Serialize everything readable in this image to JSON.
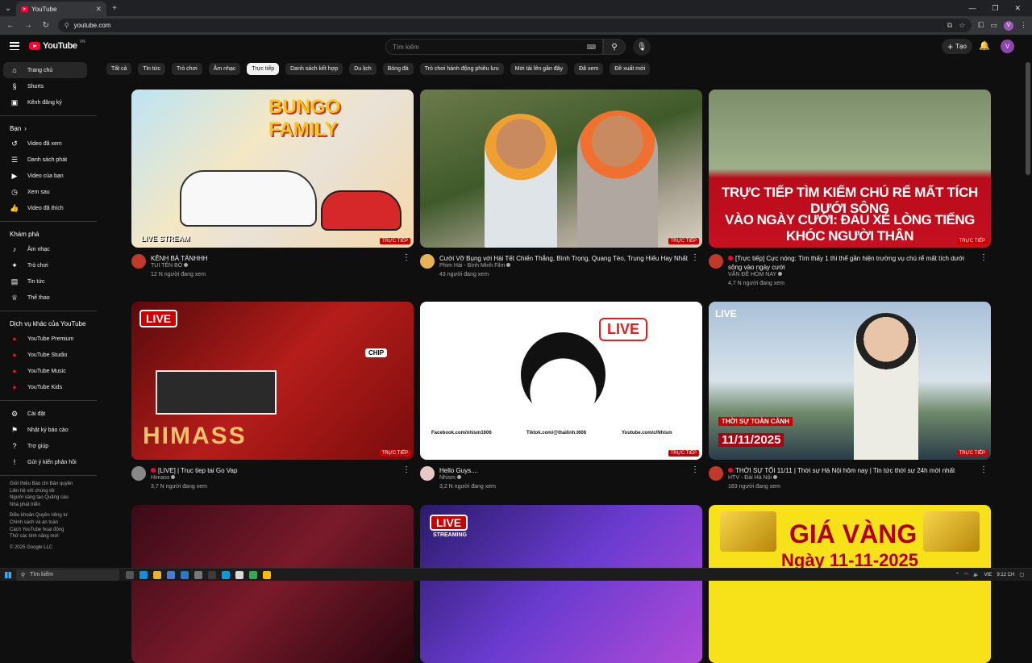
{
  "browser": {
    "tab_title": "YouTube",
    "url": "youtube.com"
  },
  "header": {
    "logo_text": "YouTube",
    "region": "VN",
    "search_placeholder": "Tìm kiếm",
    "create_label": "Tạo",
    "avatar_letter": "V"
  },
  "sidebar": {
    "main": [
      {
        "label": "Trang chủ",
        "icon": "home-icon",
        "glyph": "⌂"
      },
      {
        "label": "Shorts",
        "icon": "shorts-icon",
        "glyph": "§"
      },
      {
        "label": "Kênh đăng ký",
        "icon": "subscriptions-icon",
        "glyph": "▣"
      }
    ],
    "you_header": "Bạn",
    "you": [
      {
        "label": "Video đã xem",
        "icon": "history-icon",
        "glyph": "↺"
      },
      {
        "label": "Danh sách phát",
        "icon": "playlists-icon",
        "glyph": "☰"
      },
      {
        "label": "Video của bạn",
        "icon": "your-videos-icon",
        "glyph": "▶"
      },
      {
        "label": "Xem sau",
        "icon": "watch-later-icon",
        "glyph": "◷"
      },
      {
        "label": "Video đã thích",
        "icon": "liked-videos-icon",
        "glyph": "👍"
      }
    ],
    "explore_header": "Khám phá",
    "explore": [
      {
        "label": "Âm nhạc",
        "icon": "music-icon",
        "glyph": "♪"
      },
      {
        "label": "Trò chơi",
        "icon": "gaming-icon",
        "glyph": "✦"
      },
      {
        "label": "Tin tức",
        "icon": "news-icon",
        "glyph": "▤"
      },
      {
        "label": "Thể thao",
        "icon": "sports-icon",
        "glyph": "♕"
      }
    ],
    "more_header": "Dịch vụ khác của YouTube",
    "more": [
      {
        "label": "YouTube Premium",
        "icon": "youtube-premium-icon",
        "glyph": "●"
      },
      {
        "label": "YouTube Studio",
        "icon": "youtube-studio-icon",
        "glyph": "●"
      },
      {
        "label": "YouTube Music",
        "icon": "youtube-music-icon",
        "glyph": "●"
      },
      {
        "label": "YouTube Kids",
        "icon": "youtube-kids-icon",
        "glyph": "●"
      }
    ],
    "settings": [
      {
        "label": "Cài đặt",
        "icon": "settings-icon",
        "glyph": "⚙"
      },
      {
        "label": "Nhật ký báo cáo",
        "icon": "report-history-icon",
        "glyph": "⚑"
      },
      {
        "label": "Trợ giúp",
        "icon": "help-icon",
        "glyph": "?"
      },
      {
        "label": "Gửi ý kiến phản hồi",
        "icon": "feedback-icon",
        "glyph": "!"
      }
    ],
    "footer1": [
      "Giới thiệu  Báo chí  Bản quyền",
      "Liên hệ với chúng tôi",
      "Người sáng tạo  Quảng cáo",
      "Nhà phát triển"
    ],
    "footer2": [
      "Điều khoản  Quyền riêng tư",
      "Chính sách và an toàn",
      "Cách YouTube hoạt động",
      "Thử các tính năng mới"
    ],
    "copyright": "© 2025 Google LLC"
  },
  "chips": [
    "Tất cả",
    "Tin tức",
    "Trò chơi",
    "Âm nhạc",
    "Trực tiếp",
    "Danh sách kết hợp",
    "Du lịch",
    "Bóng đá",
    "Trò chơi hành động phiêu lưu",
    "Mới tải lên gần đây",
    "Đã xem",
    "Đề xuất mới"
  ],
  "active_chip": "Trực tiếp",
  "live_label": "TRỰC TIẾP",
  "videos": [
    {
      "title": "KÊNH BÁ TÁNHHH",
      "channel": "TUI TÊN BÔ",
      "views": "12 N người đang xem",
      "live_dot": false,
      "overlay": "BUNGO FAMILY",
      "overlay2": "LIVE STREAM"
    },
    {
      "title": "Cười Vỡ Bụng với Hài Tết Chiến Thắng, Bình Trọng, Quang Tèo, Trung Hiếu Hay Nhất",
      "channel": "Phim Hài - Bình Minh Film",
      "views": "43 người đang xem",
      "live_dot": false
    },
    {
      "title": "[Trực tiếp] Cực nóng: Tìm thấy 1 thi thể gần hiện trường vụ chú rể mất tích dưới sông vào ngày cưới",
      "channel": "VẤN ĐỀ HÔM NAY",
      "views": "4,7 N người đang xem",
      "live_dot": true,
      "overlay": "TRỰC TIẾP TÌM KIẾM CHÚ RỂ MẤT TÍCH DƯỚI SÔNG",
      "overlay2": "VÀO NGÀY CƯỚI: ĐAU XÉ LÒNG TIẾNG KHÓC NGƯỜI THÂN"
    },
    {
      "title": "[LIVE] | Truc tiep tai Go Vap",
      "channel": "Himass",
      "views": "3,7 N người đang xem",
      "live_dot": true,
      "overlay": "HIMASS",
      "overlay2": "LIVE",
      "overlay3": "CHIP"
    },
    {
      "title": "Hello Guys....",
      "channel": "Nhism",
      "views": "3,2 N người đang xem",
      "live_dot": false,
      "overlay": "LIVE",
      "links": [
        "Facebook.com/nhism1606",
        "Tiktok.com/@thailinh.t606",
        "Youtube.com/c/Nhism"
      ]
    },
    {
      "title": "THỜI SỰ TỐI 11/11 | Thời sự Hà Nội hôm nay | Tin tức thời sự 24h mới nhất",
      "channel": "HTV - Đài Hà Nội",
      "views": "183 người đang xem",
      "live_dot": true,
      "overlay": "LIVE",
      "overlay2": "THỜI SỰ TOÀN CẢNH",
      "overlay3": "11/11/2025"
    },
    {
      "title": "",
      "channel": "",
      "views": ""
    },
    {
      "title": "",
      "channel": "",
      "views": "",
      "overlay": "LIVE",
      "overlay2": "STREAMING"
    },
    {
      "title": "",
      "channel": "",
      "views": "",
      "overlay": "GIÁ VÀNG",
      "overlay2": "Ngày 11-11-2025"
    }
  ],
  "taskbar": {
    "search_placeholder": "Tìm kiếm",
    "lang": "VIE",
    "time": "9:12 CH"
  }
}
